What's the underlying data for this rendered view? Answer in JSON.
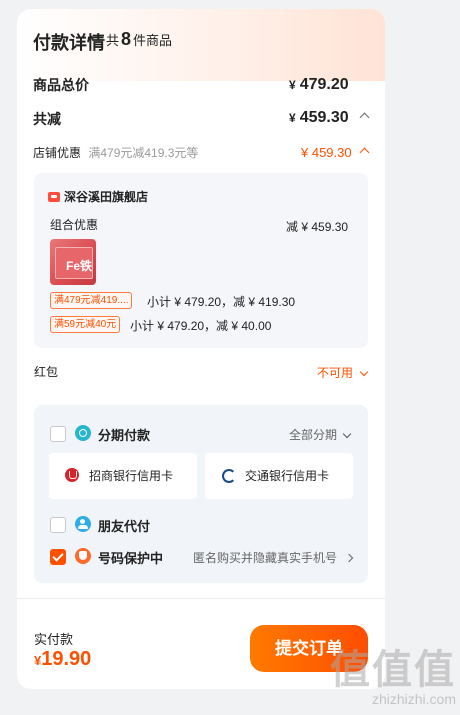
{
  "header": {
    "title": "付款详情",
    "count_prefix": "共",
    "count": "8",
    "count_suffix": "件商品"
  },
  "summary": {
    "total_label": "商品总价",
    "total_currency": "¥",
    "total_value": "479.20",
    "discount_label": "共减",
    "discount_currency": "¥",
    "discount_value": "459.30",
    "store_discount_label": "店铺优惠",
    "store_discount_desc": "满479元减419.3元等",
    "store_discount_value": "¥ 459.30"
  },
  "store_card": {
    "store_name": "深谷溪田旗舰店",
    "combo_label": "组合优惠",
    "combo_value": "减 ¥ 459.30",
    "product_badge": "Fe铁",
    "lines": [
      {
        "tag": "满479元减419....",
        "text": "小计 ¥ 479.20，减 ¥ 419.30"
      },
      {
        "tag": "满59元减40元",
        "text": "小计 ¥ 479.20，减 ¥ 40.00"
      }
    ]
  },
  "red_packet": {
    "label": "红包",
    "status": "不可用"
  },
  "payment": {
    "installment_label": "分期付款",
    "installment_option": "全部分期",
    "banks": [
      "招商银行信用卡",
      "交通银行信用卡"
    ],
    "friend_pay_label": "朋友代付",
    "privacy_label": "号码保护中",
    "privacy_desc": "匿名购买并隐藏真实手机号"
  },
  "footer": {
    "paid_label": "实付款",
    "paid_currency": "¥",
    "paid_value": "19.90",
    "submit_label": "提交订单"
  },
  "watermark": {
    "glyphs": "值值值",
    "url": "zhizhizhi.com"
  },
  "colors": {
    "accent": "#ff5000",
    "button_gradient_start": "#ff7a00",
    "button_gradient_end": "#ff4d00"
  },
  "icons": [
    "store-logo-icon",
    "chevron-up-icon",
    "chevron-down-icon",
    "chevron-right-icon",
    "installment-icon",
    "cmb-bank-icon",
    "bocom-bank-icon",
    "friend-pay-icon",
    "shield-icon",
    "checkbox-icon"
  ]
}
